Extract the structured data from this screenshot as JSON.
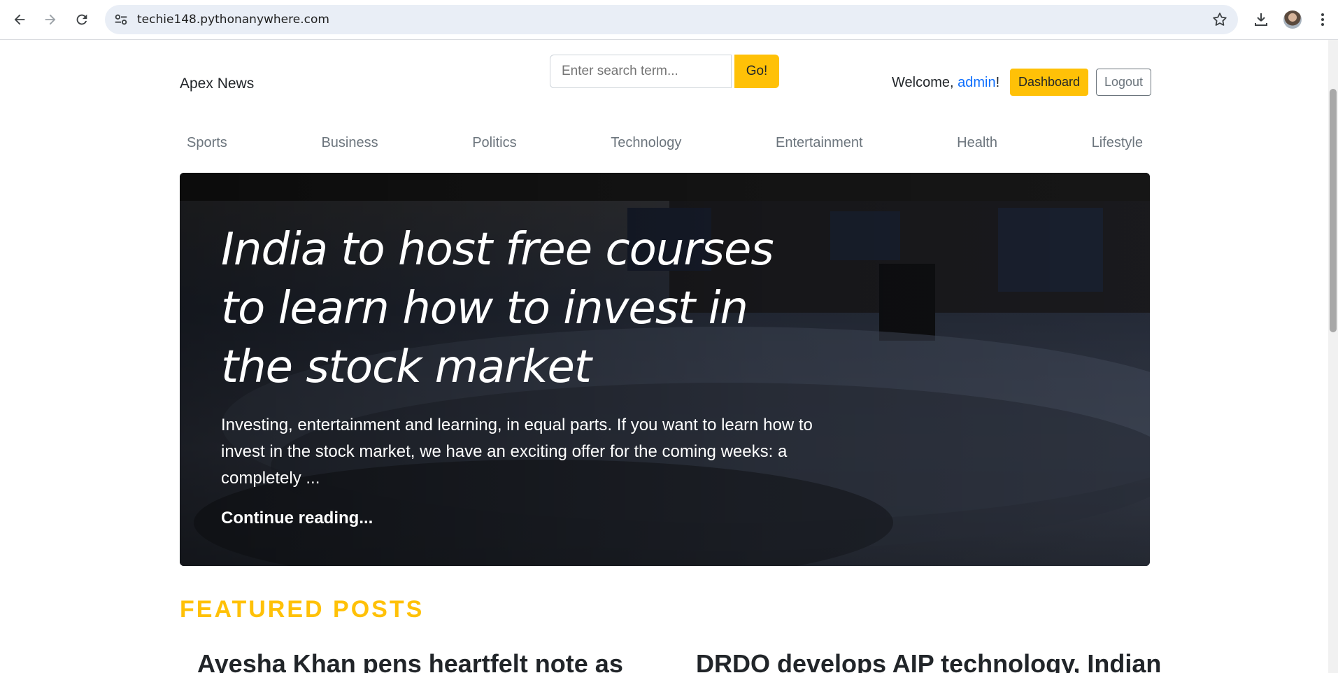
{
  "browser": {
    "url": "techie148.pythonanywhere.com"
  },
  "header": {
    "brand": "Apex News",
    "search_placeholder": "Enter search term...",
    "search_button": "Go!",
    "welcome_prefix": "Welcome, ",
    "username": "admin",
    "welcome_suffix": "!",
    "dashboard_button": "Dashboard",
    "logout_button": "Logout"
  },
  "categories": [
    "Sports",
    "Business",
    "Politics",
    "Technology",
    "Entertainment",
    "Health",
    "Lifestyle"
  ],
  "hero": {
    "title": "India to host free courses to learn how to invest in the stock market",
    "lead": "Investing, entertainment and learning, in equal parts. If you want to learn how to invest in the stock market, we have an exciting offer for the coming weeks: a completely ...",
    "link": "Continue reading..."
  },
  "featured": {
    "heading": "FEATURED POSTS",
    "posts": [
      {
        "title": "Ayesha Khan pens heartfelt note as"
      },
      {
        "title": "DRDO develops AIP technology, Indian"
      }
    ]
  },
  "colors": {
    "accent": "#ffc107",
    "link": "#0d6efd",
    "muted": "#6c757d"
  }
}
